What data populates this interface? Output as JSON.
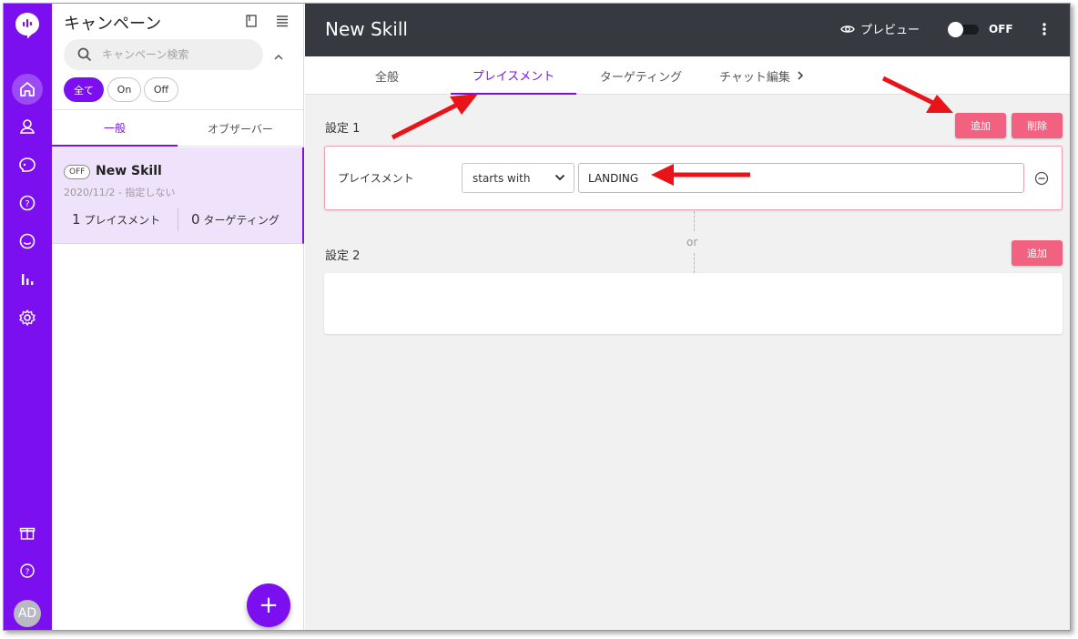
{
  "rail": {
    "avatar": "AD",
    "icons": [
      "logo-icon",
      "home-icon",
      "users-icon",
      "chat-icon",
      "help-bubble-icon",
      "smile-icon",
      "bar-chart-icon",
      "gear-icon",
      "gift-icon",
      "help-circle-icon"
    ]
  },
  "panel": {
    "title": "キャンペーン",
    "search_placeholder": "キャンペーン検索",
    "filters": [
      "全て",
      "On",
      "Off"
    ],
    "subtabs": [
      "一般",
      "オブザーバー"
    ],
    "campaign": {
      "status": "OFF",
      "name": "New Skill",
      "meta": "2020/11/2 - 指定しない",
      "placement_count": "1",
      "placement_label": "プレイスメント",
      "targeting_count": "0",
      "targeting_label": "ターゲティング"
    },
    "fab": "+"
  },
  "header": {
    "title": "New Skill",
    "preview_label": "プレビュー",
    "toggle_label": "OFF"
  },
  "tabs": [
    "全般",
    "プレイスメント",
    "ターゲティング",
    "チャット編集"
  ],
  "settings": {
    "set1_label": "設定 1",
    "add_label": "追加",
    "delete_label": "削除",
    "rule_label": "プレイスメント",
    "operator": "starts with",
    "value": "LANDING",
    "or_label": "or",
    "set2_label": "設定 2",
    "add2_label": "追加"
  },
  "colors": {
    "brand": "#7b0ff0",
    "header": "#36393f",
    "button": "#f2617f",
    "annotation_arrow": "#e8141a"
  }
}
